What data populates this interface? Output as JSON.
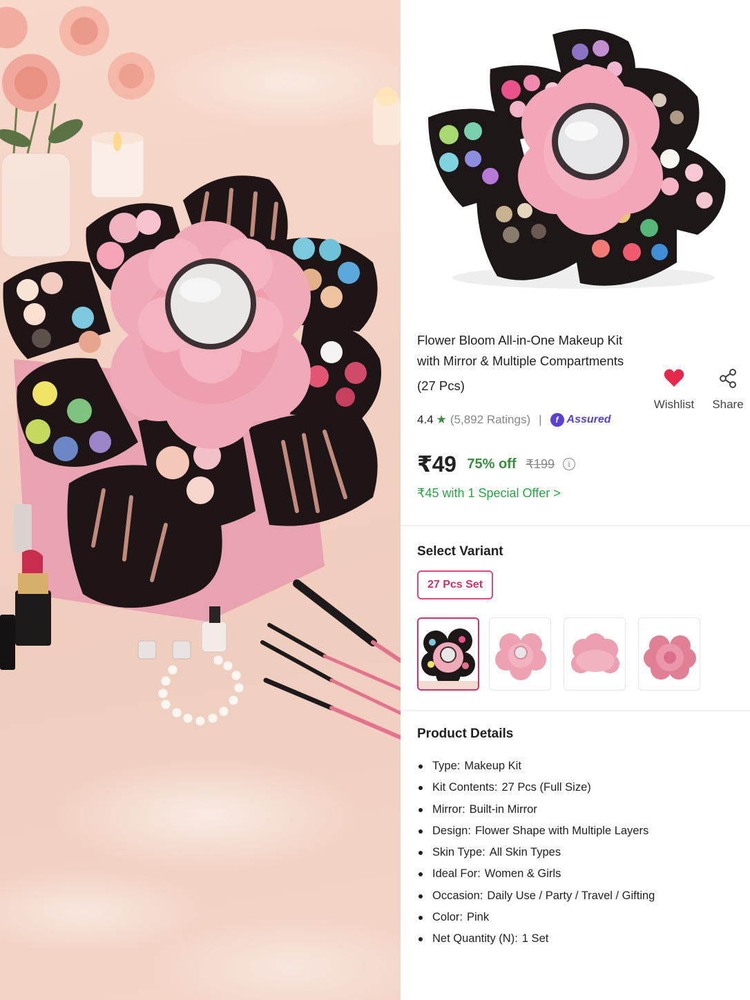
{
  "product": {
    "title_lines": [
      "Flower Bloom All-in-One Makeup Kit",
      "with Mirror & Multiple Compartments",
      "(27 Pcs)"
    ],
    "rating": "4.4",
    "ratings_count": "(5,892 Ratings)",
    "separator": "|",
    "assured_label": "Assured",
    "price": "₹49",
    "discount": "75% off",
    "mrp": "₹199",
    "special_offer": "₹45 with 1 Special Offer >"
  },
  "actions": {
    "wishlist_label": "Wishlist",
    "share_label": "Share",
    "wishlist_color": "#e5294c"
  },
  "variant": {
    "section_title": "Select Variant",
    "selected_label": "27 Pcs Set",
    "selected_thumbnail_index": 0,
    "thumbnails": [
      "flower-kit-open",
      "flower-kit-closed-front",
      "flower-kit-closed-side",
      "flower-kit-closed-top"
    ]
  },
  "details": {
    "section_title": "Product Details",
    "items": [
      {
        "key": "Type:",
        "value": "Makeup Kit"
      },
      {
        "key": "Kit Contents:",
        "value": "27 Pcs (Full Size)"
      },
      {
        "key": "Mirror:",
        "value": "Built-in Mirror"
      },
      {
        "key": "Design:",
        "value": "Flower Shape with Multiple Layers"
      },
      {
        "key": "Skin Type:",
        "value": "All Skin Types"
      },
      {
        "key": "Ideal For:",
        "value": "Women & Girls"
      },
      {
        "key": "Occasion:",
        "value": "Daily Use / Party / Travel / Gifting"
      },
      {
        "key": "Color:",
        "value": "Pink"
      },
      {
        "key": "Net Quantity (N):",
        "value": "1 Set"
      }
    ]
  },
  "colors": {
    "accent_pink": "#d1306b",
    "offer_green": "#26a541",
    "discount_green": "#388e3c",
    "assured_purple": "#5b3fd6"
  }
}
